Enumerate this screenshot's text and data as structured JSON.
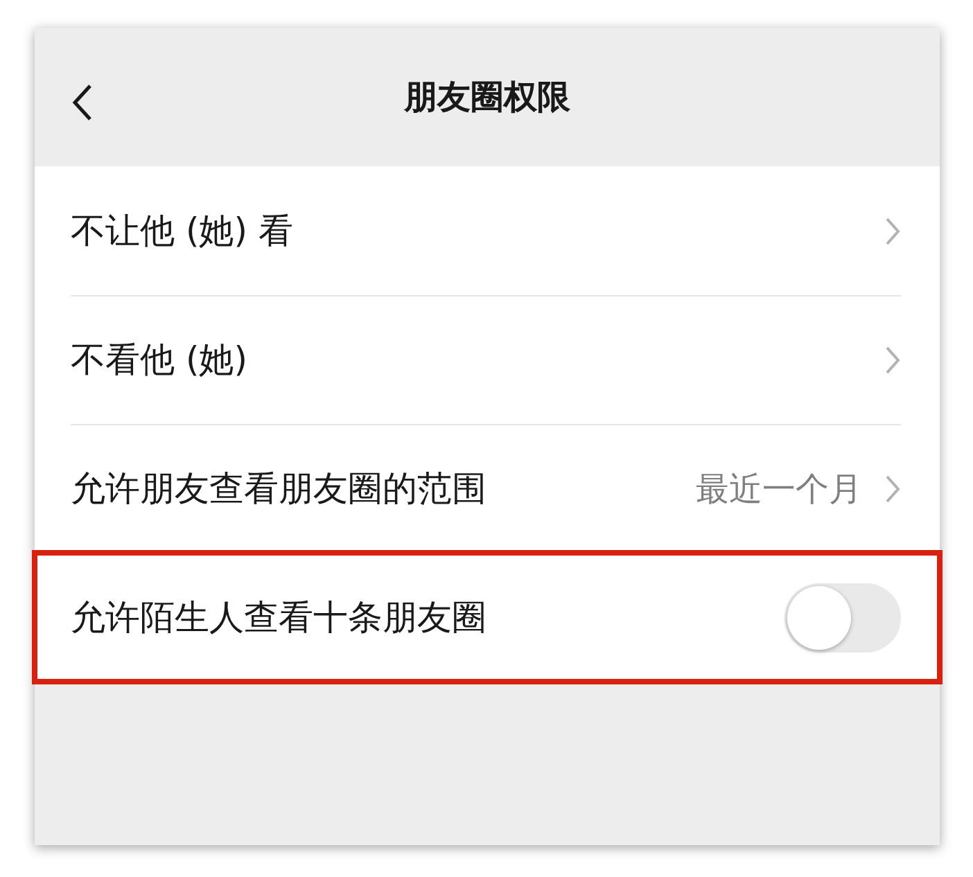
{
  "header": {
    "title": "朋友圈权限"
  },
  "rows": [
    {
      "kind": "link",
      "label": "不让他 (她) 看",
      "highlighted": false
    },
    {
      "kind": "link",
      "label": "不看他 (她)",
      "highlighted": false
    },
    {
      "kind": "link",
      "label": "允许朋友查看朋友圈的范围",
      "value": "最近一个月",
      "highlighted": false
    },
    {
      "kind": "toggle",
      "label": "允许陌生人查看十条朋友圈",
      "on": false,
      "highlighted": true
    }
  ]
}
